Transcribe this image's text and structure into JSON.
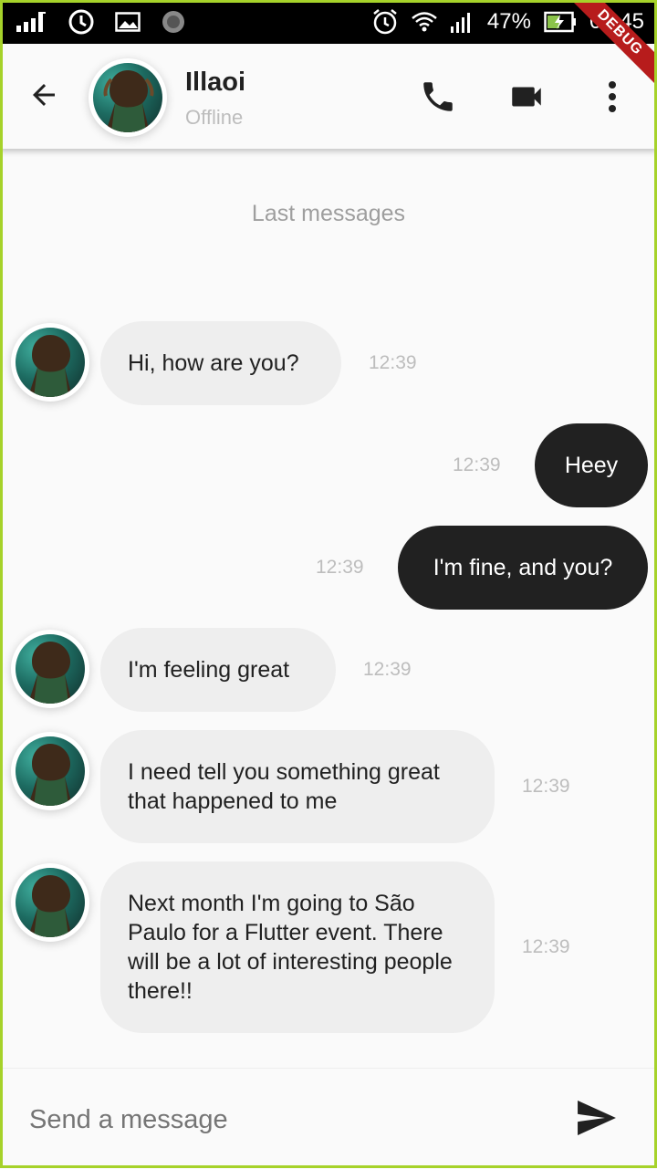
{
  "status_bar": {
    "battery": "47%",
    "time": "00:45",
    "icons": [
      "signal-bars-icon",
      "sync-icon",
      "image-icon",
      "loading-icon",
      "alarm-icon",
      "wifi-icon",
      "cell-signal-icon",
      "battery-charging-icon"
    ]
  },
  "debug_banner": "DEBUG",
  "app_bar": {
    "title": "Illaoi",
    "subtitle": "Offline",
    "icons": [
      "back-arrow-icon",
      "phone-icon",
      "video-camera-icon",
      "more-vert-icon"
    ]
  },
  "chat": {
    "section_title": "Last messages",
    "messages": [
      {
        "from": "them",
        "text": "Hi, how are you?",
        "time": "12:39"
      },
      {
        "from": "me",
        "text": "Heey",
        "time": "12:39"
      },
      {
        "from": "me",
        "text": "I'm fine, and you?",
        "time": "12:39"
      },
      {
        "from": "them",
        "text": "I'm feeling great",
        "time": "12:39"
      },
      {
        "from": "them",
        "text": "I need tell you something great that happened to me",
        "time": "12:39"
      },
      {
        "from": "them",
        "text": "Next month I'm going to São Paulo for a Flutter event. There will be a lot of interesting people there!!",
        "time": "12:39"
      }
    ]
  },
  "composer": {
    "placeholder": "Send a message",
    "value": ""
  },
  "colors": {
    "outgoing_bubble": "#212121",
    "incoming_bubble": "#eeeeee",
    "accent_frame": "#a6d22a",
    "debug_banner": "#b71c1c"
  }
}
